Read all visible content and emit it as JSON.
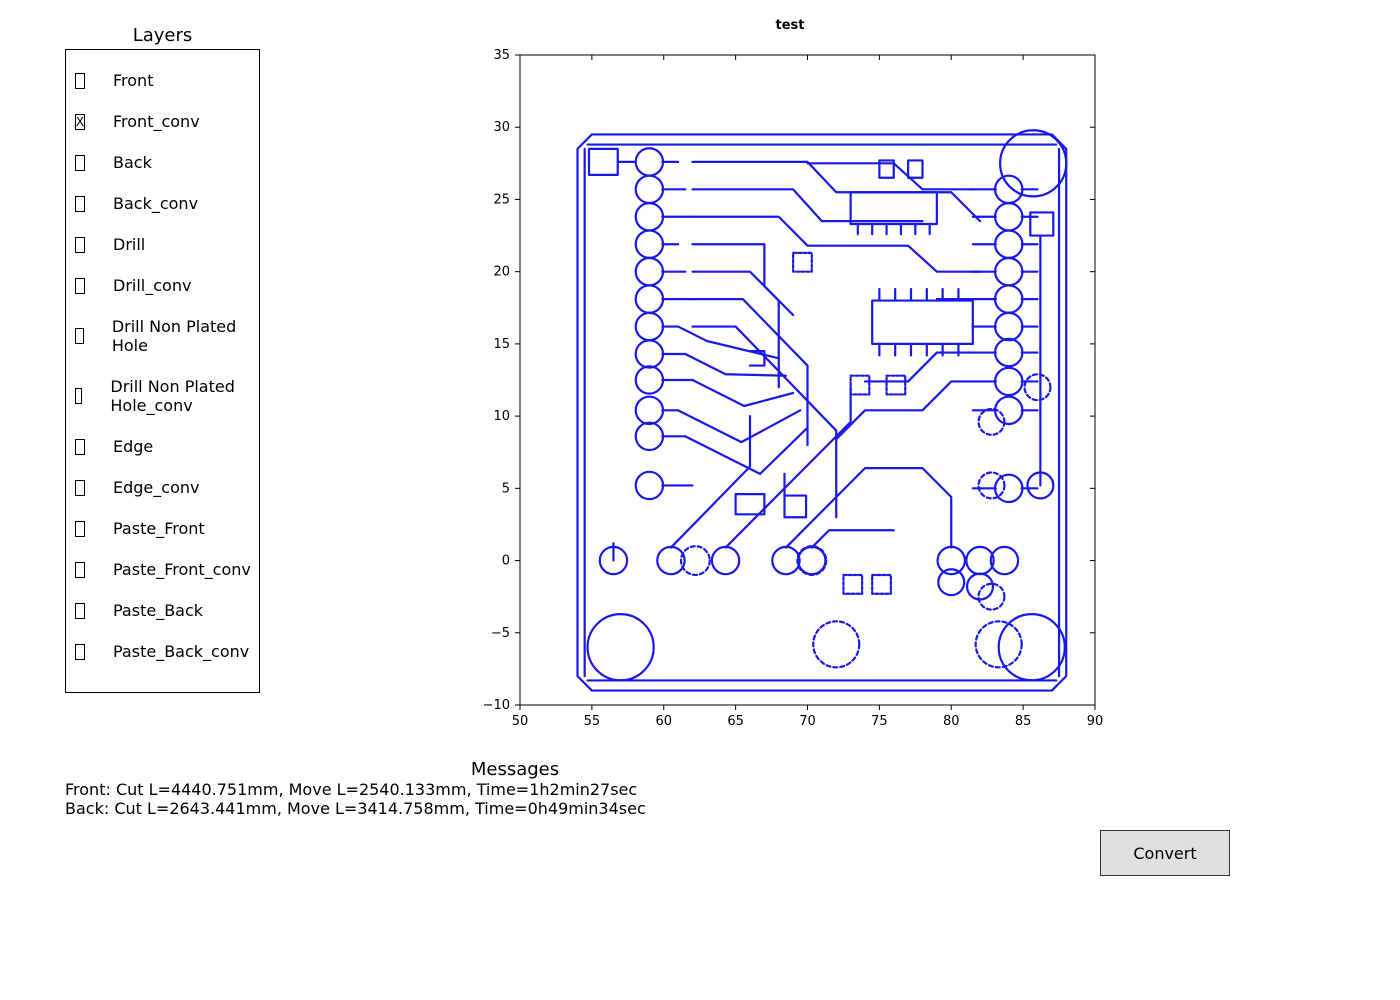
{
  "layers": {
    "title": "Layers",
    "items": [
      {
        "label": "Front",
        "checked": false
      },
      {
        "label": "Front_conv",
        "checked": true
      },
      {
        "label": "Back",
        "checked": false
      },
      {
        "label": "Back_conv",
        "checked": false
      },
      {
        "label": "Drill",
        "checked": false
      },
      {
        "label": "Drill_conv",
        "checked": false
      },
      {
        "label": "Drill Non Plated Hole",
        "checked": false
      },
      {
        "label": "Drill Non Plated Hole_conv",
        "checked": false
      },
      {
        "label": "Edge",
        "checked": false
      },
      {
        "label": "Edge_conv",
        "checked": false
      },
      {
        "label": "Paste_Front",
        "checked": false
      },
      {
        "label": "Paste_Front_conv",
        "checked": false
      },
      {
        "label": "Paste_Back",
        "checked": false
      },
      {
        "label": "Paste_Back_conv",
        "checked": false
      }
    ]
  },
  "plot": {
    "title": "test"
  },
  "chart_data": {
    "type": "pcb-plot",
    "title": "test",
    "xlabel": "",
    "ylabel": "",
    "xlim": [
      50,
      90
    ],
    "ylim": [
      -10,
      35
    ],
    "xticks": [
      50,
      55,
      60,
      65,
      70,
      75,
      80,
      85,
      90
    ],
    "yticks": [
      -10,
      -5,
      0,
      5,
      10,
      15,
      20,
      25,
      30,
      35
    ],
    "trace_color": "#1818e8",
    "board_outline": {
      "x": [
        54,
        88
      ],
      "y": [
        -9,
        29.5
      ]
    },
    "large_mounting_holes": [
      {
        "x": 57,
        "y": -6,
        "r": 2.3
      },
      {
        "x": 85.6,
        "y": -6,
        "r": 2.3
      },
      {
        "x": 85.7,
        "y": 27.5,
        "r": 2.3
      }
    ],
    "left_pad_column_x": 59,
    "left_pad_ys": [
      27.6,
      25.7,
      23.8,
      21.9,
      20.0,
      18.1,
      16.2,
      14.3,
      12.5,
      10.4,
      8.6,
      5.2
    ],
    "right_pad_column_x": 84,
    "right_pad_ys": [
      25.7,
      23.8,
      21.9,
      20.0,
      18.1,
      16.2,
      14.4,
      12.4,
      10.4,
      5.0
    ],
    "bottom_pad_row_y": 0,
    "bottom_pad_xs": [
      56.5,
      60.5,
      64.3,
      68.5,
      70.3,
      80.0,
      82.0,
      83.7
    ],
    "dashed_circles": [
      {
        "x": 62.2,
        "y": 0,
        "r": 1.0
      },
      {
        "x": 70.3,
        "y": 0,
        "r": 1.0
      },
      {
        "x": 72.0,
        "y": -5.8,
        "r": 1.6
      },
      {
        "x": 83.3,
        "y": -5.8,
        "r": 1.6
      },
      {
        "x": 82.8,
        "y": 5.2,
        "r": 0.9
      },
      {
        "x": 82.8,
        "y": 9.6,
        "r": 0.9
      },
      {
        "x": 82.8,
        "y": -2.5,
        "r": 0.9
      },
      {
        "x": 86.0,
        "y": 12.0,
        "r": 0.9
      }
    ],
    "dashed_rects": [
      {
        "x": 69.0,
        "y": 20.0,
        "w": 1.3,
        "h": 1.3
      },
      {
        "x": 73.0,
        "y": 11.5,
        "w": 1.3,
        "h": 1.3
      },
      {
        "x": 75.5,
        "y": 11.5,
        "w": 1.3,
        "h": 1.3
      },
      {
        "x": 72.5,
        "y": -2.3,
        "w": 1.3,
        "h": 1.3
      },
      {
        "x": 74.5,
        "y": -2.3,
        "w": 1.3,
        "h": 1.3
      }
    ]
  },
  "messages": {
    "title": "Messages",
    "lines": [
      "Front: Cut L=4440.751mm, Move L=2540.133mm, Time=1h2min27sec",
      "Back: Cut L=2643.441mm, Move L=3414.758mm, Time=0h49min34sec"
    ]
  },
  "buttons": {
    "convert": "Convert"
  }
}
